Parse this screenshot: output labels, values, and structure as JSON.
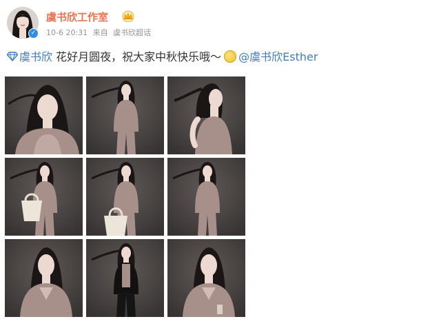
{
  "post": {
    "author": {
      "name": "虞书欣工作室",
      "verified_icon": "verified-badge-icon",
      "badge_icon": "crown-icon"
    },
    "meta": {
      "time": "10-6 20:31",
      "source_prefix": "来自",
      "source": "虞书欣超话"
    },
    "content": {
      "tag_icon": "diamond-icon",
      "tag": "虞书欣",
      "text": "花好月圆夜，祝大家中秋快乐哦～",
      "emoji": "moon-emoji",
      "mention": "@虞书欣Esther"
    },
    "images": [
      {
        "label": "photo-1",
        "scene": "closeup"
      },
      {
        "label": "photo-2",
        "scene": "standing"
      },
      {
        "label": "photo-3",
        "scene": "profile"
      },
      {
        "label": "photo-4",
        "scene": "bag"
      },
      {
        "label": "photo-5",
        "scene": "bag-low"
      },
      {
        "label": "photo-6",
        "scene": "jacket"
      },
      {
        "label": "photo-7",
        "scene": "portrait"
      },
      {
        "label": "photo-8",
        "scene": "black-jacket"
      },
      {
        "label": "photo-9",
        "scene": "cardigan"
      }
    ]
  },
  "colors": {
    "accent": "#eb7350",
    "link_blue": "#3e7cc4",
    "meta_gray": "#939393",
    "photo_bg": "#4a4645",
    "outfit": "#a8908a",
    "skin": "#ecd9cf",
    "hair": "#1a1615"
  }
}
